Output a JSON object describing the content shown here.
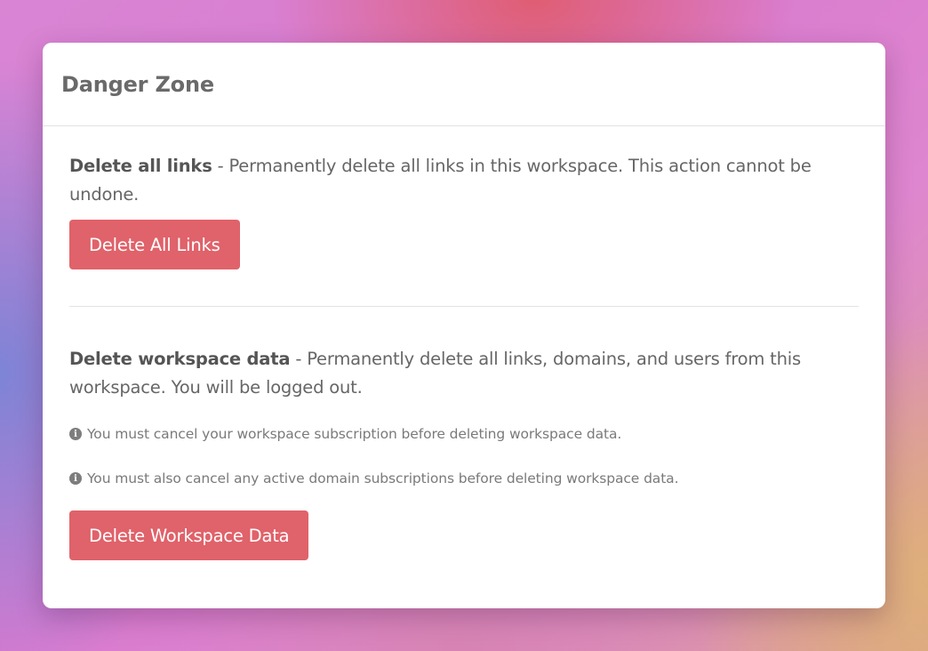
{
  "card": {
    "title": "Danger Zone"
  },
  "delete_links": {
    "title": "Delete all links",
    "description": " - Permanently delete all links in this workspace. This action cannot be undone.",
    "button_label": "Delete All Links"
  },
  "delete_workspace": {
    "title": "Delete workspace data",
    "description": " - Permanently delete all links, domains, and users from this workspace. You will be logged out.",
    "notes": [
      {
        "icon": "info-icon",
        "text": "You must cancel your workspace subscription before deleting workspace data."
      },
      {
        "icon": "info-icon",
        "text": "You must also cancel any active domain subscriptions before deleting workspace data."
      }
    ],
    "button_label": "Delete Workspace Data"
  },
  "colors": {
    "danger_button": "#e0626a",
    "card_background": "#ffffff",
    "text": "#666666"
  }
}
